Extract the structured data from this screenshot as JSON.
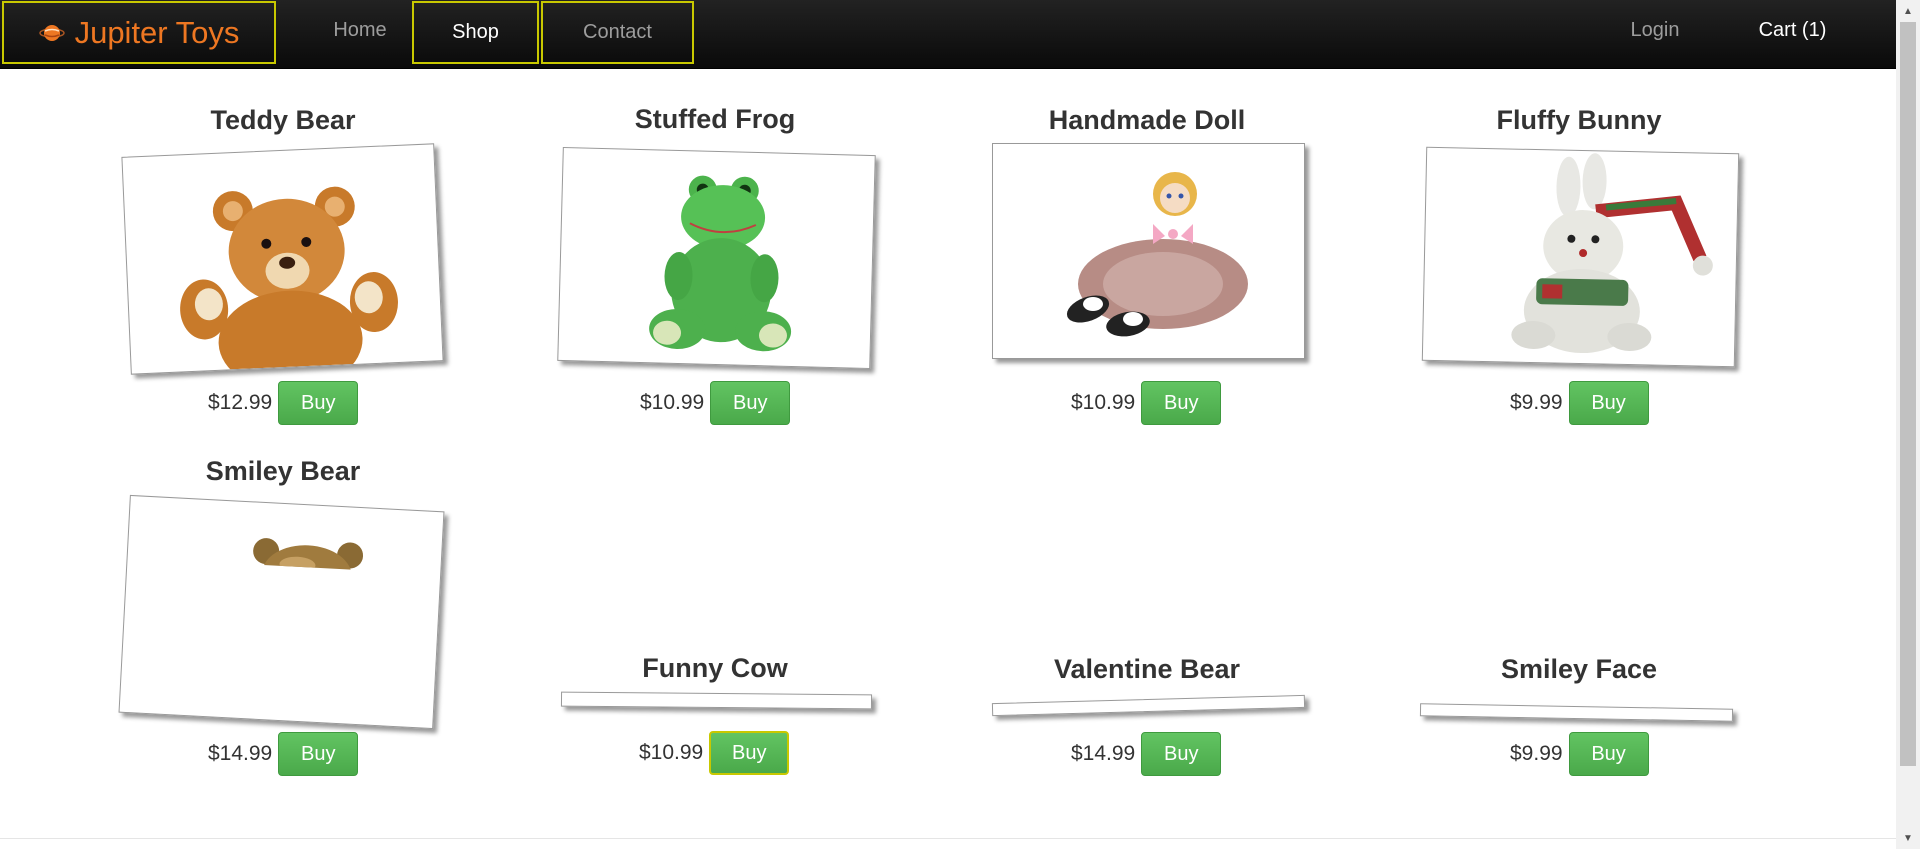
{
  "navbar": {
    "brand": "Jupiter Toys",
    "links": {
      "home": "Home",
      "shop": "Shop",
      "contact": "Contact",
      "login": "Login",
      "cart": "Cart (1)"
    }
  },
  "products": [
    {
      "title": "Teddy Bear",
      "price": "$12.99",
      "buy": "Buy"
    },
    {
      "title": "Stuffed Frog",
      "price": "$10.99",
      "buy": "Buy"
    },
    {
      "title": "Handmade Doll",
      "price": "$10.99",
      "buy": "Buy"
    },
    {
      "title": "Fluffy Bunny",
      "price": "$9.99",
      "buy": "Buy"
    },
    {
      "title": "Smiley Bear",
      "price": "$14.99",
      "buy": "Buy"
    },
    {
      "title": "Funny Cow",
      "price": "$10.99",
      "buy": "Buy"
    },
    {
      "title": "Valentine Bear",
      "price": "$14.99",
      "buy": "Buy"
    },
    {
      "title": "Smiley Face",
      "price": "$9.99",
      "buy": "Buy"
    }
  ],
  "colors": {
    "brand": "#ee7722",
    "buy_button": "#5cb85c",
    "focus_outline": "#c8c800",
    "navbar": "#111111"
  }
}
